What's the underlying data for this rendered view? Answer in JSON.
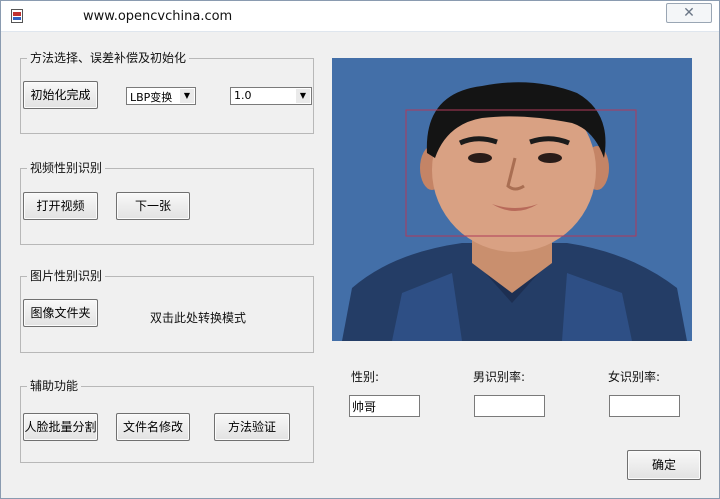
{
  "window": {
    "title": "www.opencvchina.com",
    "close_glyph": "✕",
    "icon": "app-icon"
  },
  "groups": {
    "method": {
      "label": "方法选择、误差补偿及初始化",
      "init_button": "初始化完成",
      "method_select": {
        "value": "LBP变换"
      },
      "scale_select": {
        "value": "1.0"
      }
    },
    "video": {
      "label": "视频性别识别",
      "open_button": "打开视频",
      "next_button": "下一张"
    },
    "image": {
      "label": "图片性别识别",
      "folder_button": "图像文件夹",
      "hint_text": "双击此处转换模式"
    },
    "aux": {
      "label": "辅助功能",
      "face_split_button": "人脸批量分割",
      "rename_button": "文件名修改",
      "verify_button": "方法验证"
    }
  },
  "results": {
    "gender_label": "性别:",
    "gender_value": "帅哥",
    "male_rate_label": "男识别率:",
    "male_rate_value": "",
    "female_rate_label": "女识别率:",
    "female_rate_value": ""
  },
  "ok_button": "确定",
  "photo": {
    "description_icon": "face-photo",
    "detection_color": "#b03a5a",
    "background_color": "#436fa8"
  }
}
